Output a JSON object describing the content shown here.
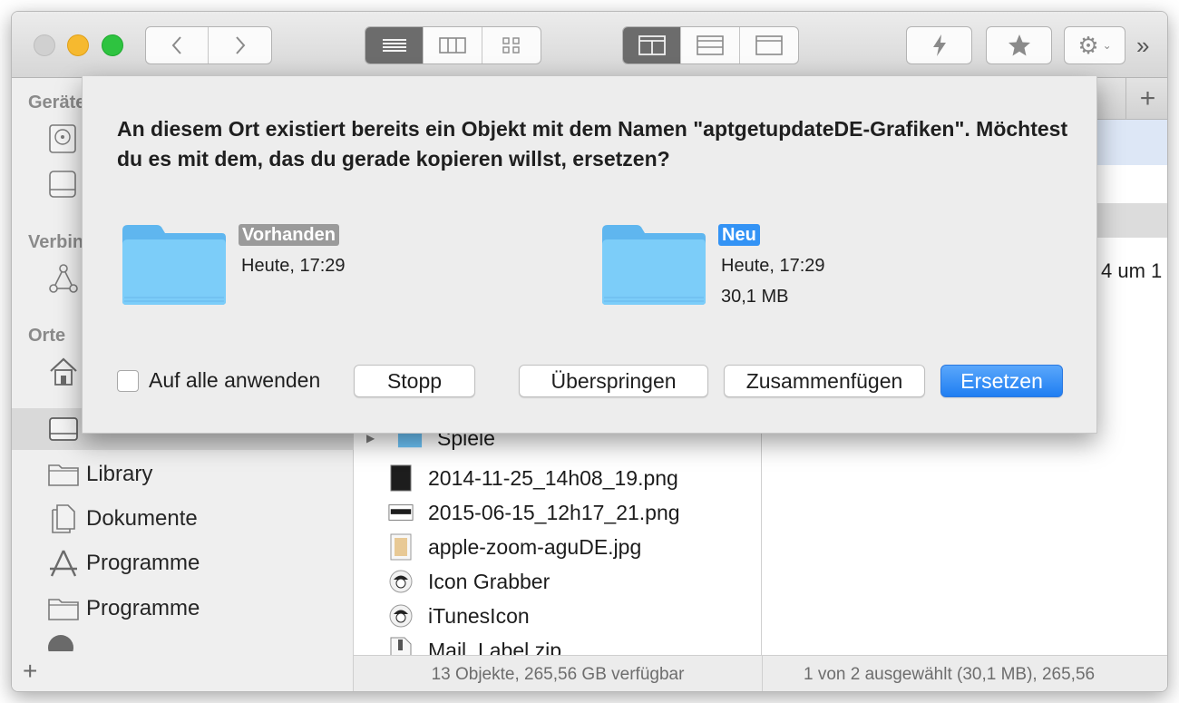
{
  "sidebar": {
    "sections": {
      "devices": "Geräte",
      "connections": "Verbin",
      "places": "Orte"
    },
    "items": [
      {
        "label": "Library",
        "icon": "folder-icon"
      },
      {
        "label": "Dokumente",
        "icon": "documents-icon"
      },
      {
        "label": "Programme",
        "icon": "applications-icon"
      },
      {
        "label": "Programme",
        "icon": "folder-icon"
      }
    ]
  },
  "files": [
    {
      "name": "Spiele",
      "icon": "folder-icon"
    },
    {
      "name": "2014-11-25_14h08_19.png",
      "icon": "image-file-icon"
    },
    {
      "name": "2015-06-15_12h17_21.png",
      "icon": "image-file-icon"
    },
    {
      "name": "apple-zoom-aguDE.jpg",
      "icon": "image-file-icon"
    },
    {
      "name": "Icon Grabber",
      "icon": "app-icon"
    },
    {
      "name": "iTunesIcon",
      "icon": "app-icon"
    },
    {
      "name": "Mail_Label.zip",
      "icon": "zip-icon"
    }
  ],
  "preview": {
    "partial_text": "4 um 1"
  },
  "status": {
    "left": "13 Objekte, 265,56 GB verfügbar",
    "right": "1 von 2 ausgewählt (30,1 MB), 265,56"
  },
  "dialog": {
    "message": "An diesem Ort existiert bereits ein Objekt mit dem Namen \"aptgetupdateDE-Grafiken\". Möchtest du es mit dem, das du gerade kopieren willst, ersetzen?",
    "existing": {
      "badge": "Vorhanden",
      "date": "Heute, 17:29"
    },
    "new": {
      "badge": "Neu",
      "date": "Heute, 17:29",
      "size": "30,1 MB"
    },
    "apply_all": "Auf alle anwenden",
    "buttons": {
      "stop": "Stopp",
      "skip": "Überspringen",
      "merge": "Zusammenfügen",
      "replace": "Ersetzen"
    }
  },
  "colors": {
    "accent": "#3393f5",
    "folder": "#6cc3f7"
  }
}
